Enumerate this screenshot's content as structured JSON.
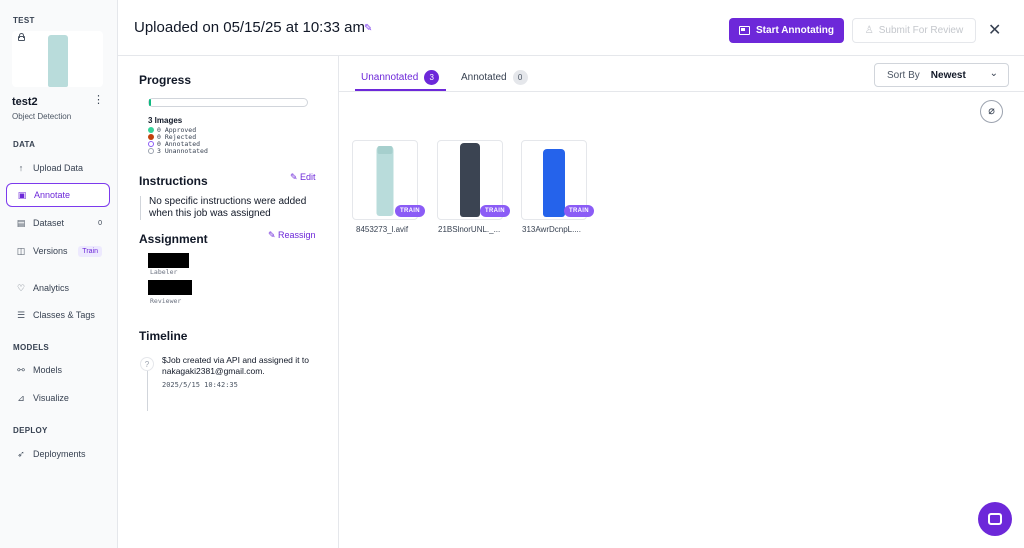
{
  "sidebar": {
    "workspace": "TEST",
    "project_name": "test2",
    "project_type": "Object Detection",
    "sections": {
      "data": "DATA",
      "models": "MODELS",
      "deploy": "DEPLOY"
    },
    "items": [
      {
        "label": "Upload Data",
        "icon": "upload-icon"
      },
      {
        "label": "Annotate",
        "icon": "annotate-icon",
        "active": true
      },
      {
        "label": "Dataset",
        "icon": "dataset-icon",
        "count": "0"
      },
      {
        "label": "Versions",
        "icon": "versions-icon",
        "tag": "Train"
      },
      {
        "label": "Analytics",
        "icon": "analytics-icon"
      },
      {
        "label": "Classes & Tags",
        "icon": "classes-icon"
      },
      {
        "label": "Models",
        "icon": "models-icon"
      },
      {
        "label": "Visualize",
        "icon": "visualize-icon"
      },
      {
        "label": "Deployments",
        "icon": "rocket-icon"
      }
    ]
  },
  "header": {
    "title": "Uploaded on 05/15/25 at 10:33 am",
    "start_label": "Start Annotating",
    "submit_label": "Submit For Review"
  },
  "panel": {
    "progress_title": "Progress",
    "progress_fraction": 0.0,
    "images_count": "3 Images",
    "legend": [
      {
        "label": "0 Approved",
        "color": "#34d399"
      },
      {
        "label": "0 Rejected",
        "color": "#c2410c"
      },
      {
        "label": "0 Annotated",
        "color": "#8b5cf6"
      },
      {
        "label": "3 Unannotated",
        "color": "#ffffff"
      }
    ],
    "instructions_title": "Instructions",
    "edit_label": "Edit",
    "instructions_text": "No specific instructions were added when this job was assigned",
    "assignment_title": "Assignment",
    "reassign_label": "Reassign",
    "labeler_role": "Labeler",
    "reviewer_role": "Reviewer",
    "timeline_title": "Timeline",
    "timeline_text": "$Job created via API and assigned it to nakagaki2381@gmail.com.",
    "timeline_time": "2025/5/15 10:42:35"
  },
  "tabs": [
    {
      "label": "Unannotated",
      "count": "3"
    },
    {
      "label": "Annotated",
      "count": "0"
    }
  ],
  "sort": {
    "label": "Sort By",
    "value": "Newest"
  },
  "images": [
    {
      "filename": "8453273_l.avif",
      "badge": "TRAIN",
      "color": "#b9dcdb"
    },
    {
      "filename": "21BSlnorUNL._...",
      "badge": "TRAIN",
      "color": "#3b4452"
    },
    {
      "filename": "313AwrDcnpL....",
      "badge": "TRAIN",
      "color": "#2563eb"
    }
  ]
}
